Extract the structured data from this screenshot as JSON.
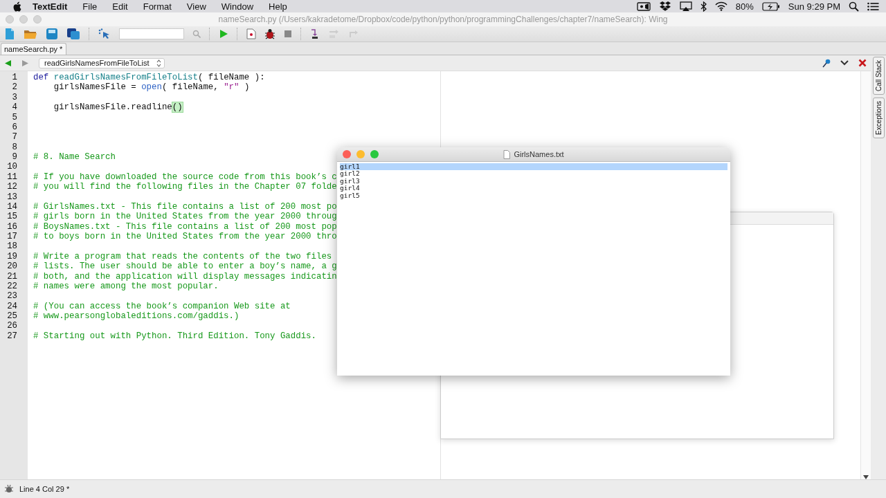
{
  "menu_bar": {
    "app": "TextEdit",
    "menus": [
      "File",
      "Edit",
      "Format",
      "View",
      "Window",
      "Help"
    ],
    "battery": "80%",
    "clock": "Sun 9:29 PM"
  },
  "window": {
    "title": "nameSearch.py (/Users/kakradetome/Dropbox/code/python/python/programmingChallenges/chapter7/nameSearch): Wing"
  },
  "editor_tabs": [
    {
      "label": "nameSearch.py *",
      "selected": true
    }
  ],
  "function_selector": {
    "value": "readGirlsNamesFromFileToList"
  },
  "code_lines": [
    {
      "number": "1",
      "tokens": [
        {
          "kind": "keyword",
          "text": "def "
        },
        {
          "kind": "function",
          "text": "readGirlsNamesFromFileToList"
        },
        {
          "kind": "plain",
          "text": "( fileName ):"
        }
      ]
    },
    {
      "number": "2",
      "tokens": [
        {
          "kind": "plain",
          "text": "    girlsNamesFile = "
        },
        {
          "kind": "builtin",
          "text": "open"
        },
        {
          "kind": "plain",
          "text": "( fileName, "
        },
        {
          "kind": "string",
          "text": "\"r\""
        },
        {
          "kind": "plain",
          "text": " )"
        }
      ]
    },
    {
      "number": "3"
    },
    {
      "number": "4",
      "tokens": [
        {
          "kind": "plain",
          "text": "    girlsNamesFile.readline"
        },
        {
          "kind": "match",
          "text": "()"
        }
      ]
    },
    {
      "number": "5"
    },
    {
      "number": "6"
    },
    {
      "number": "7"
    },
    {
      "number": "8"
    },
    {
      "number": "9",
      "tokens": [
        {
          "kind": "comment",
          "text": "# 8. Name Search"
        }
      ]
    },
    {
      "number": "10"
    },
    {
      "number": "11",
      "tokens": [
        {
          "kind": "comment",
          "text": "# If you have downloaded the source code from this book’s c"
        }
      ]
    },
    {
      "number": "12",
      "tokens": [
        {
          "kind": "comment",
          "text": "# you will find the following files in the Chapter 07 folde"
        }
      ]
    },
    {
      "number": "13"
    },
    {
      "number": "14",
      "tokens": [
        {
          "kind": "comment",
          "text": "# GirlsNames.txt - This file contains a list of 200 most po"
        }
      ]
    },
    {
      "number": "15",
      "tokens": [
        {
          "kind": "comment",
          "text": "# girls born in the United States from the year 2000 throug"
        }
      ]
    },
    {
      "number": "16",
      "tokens": [
        {
          "kind": "comment",
          "text": "# BoysNames.txt - This file contains a list of 200 most pop"
        }
      ]
    },
    {
      "number": "17",
      "tokens": [
        {
          "kind": "comment",
          "text": "# to boys born in the United States from the year 2000 thro"
        }
      ]
    },
    {
      "number": "18"
    },
    {
      "number": "19",
      "tokens": [
        {
          "kind": "comment",
          "text": "# Write a program that reads the contents of the two files"
        }
      ]
    },
    {
      "number": "20",
      "tokens": [
        {
          "kind": "comment",
          "text": "# lists. The user should be able to enter a boy’s name, a g"
        }
      ]
    },
    {
      "number": "21",
      "tokens": [
        {
          "kind": "comment",
          "text": "# both, and the application will display messages indicatin"
        }
      ]
    },
    {
      "number": "22",
      "tokens": [
        {
          "kind": "comment",
          "text": "# names were among the most popular."
        }
      ]
    },
    {
      "number": "23"
    },
    {
      "number": "24",
      "tokens": [
        {
          "kind": "comment",
          "text": "# (You can access the book’s companion Web site at"
        }
      ]
    },
    {
      "number": "25",
      "tokens": [
        {
          "kind": "comment",
          "text": "# www.pearsonglobaleditions.com/gaddis.)"
        }
      ]
    },
    {
      "number": "26"
    },
    {
      "number": "27",
      "tokens": [
        {
          "kind": "comment",
          "text": "# Starting out with Python. Third Edition. Tony Gaddis."
        }
      ]
    }
  ],
  "side_tabs": [
    "Call Stack",
    "Exceptions"
  ],
  "text_window": {
    "title": "GirlsNames.txt",
    "lines": [
      {
        "text": "girl1",
        "selected": true
      },
      {
        "text": "girl2",
        "selected": false
      },
      {
        "text": "girl3",
        "selected": false
      },
      {
        "text": "girl4",
        "selected": false
      },
      {
        "text": "girl5",
        "selected": false
      }
    ]
  },
  "status_bar": {
    "position": "Line 4 Col 29 *"
  }
}
